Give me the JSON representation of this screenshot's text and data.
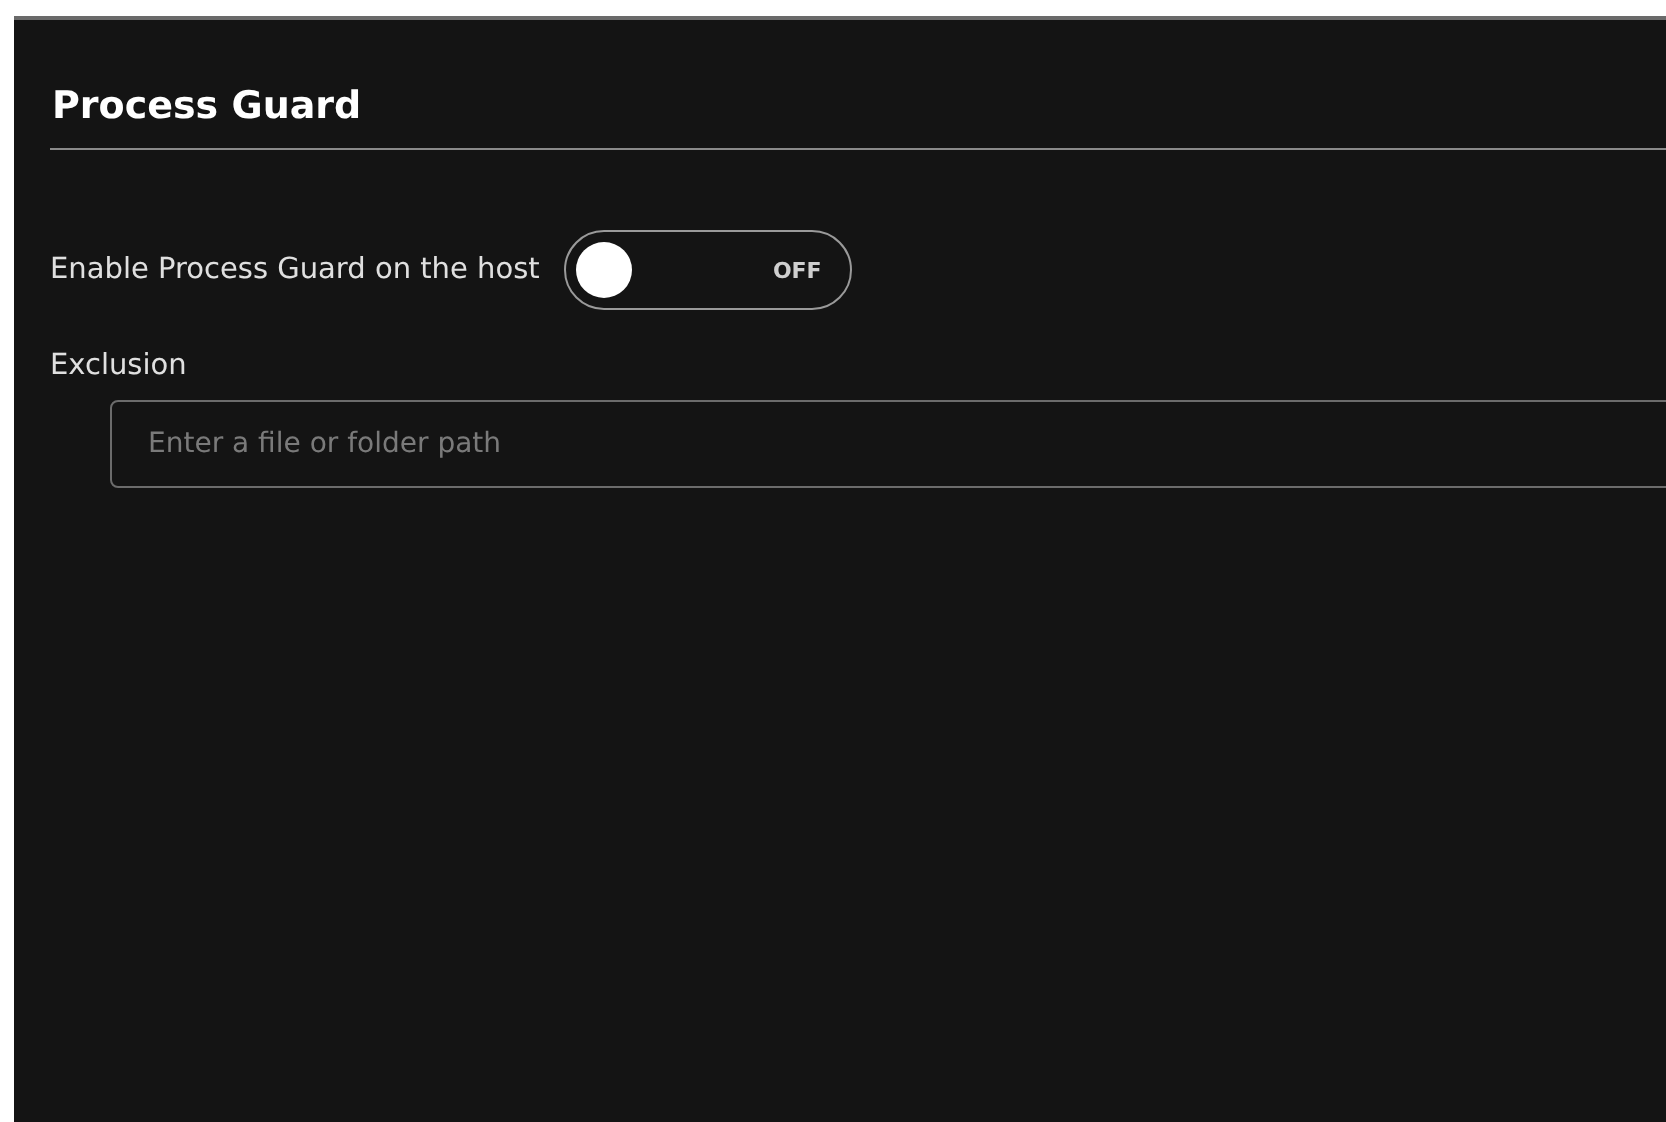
{
  "section": {
    "title": "Process Guard"
  },
  "toggle": {
    "label": "Enable Process Guard on the host",
    "on": false,
    "state_text": "OFF"
  },
  "exclusion": {
    "label": "Exclusion",
    "placeholder": "Enter a file or folder path"
  }
}
